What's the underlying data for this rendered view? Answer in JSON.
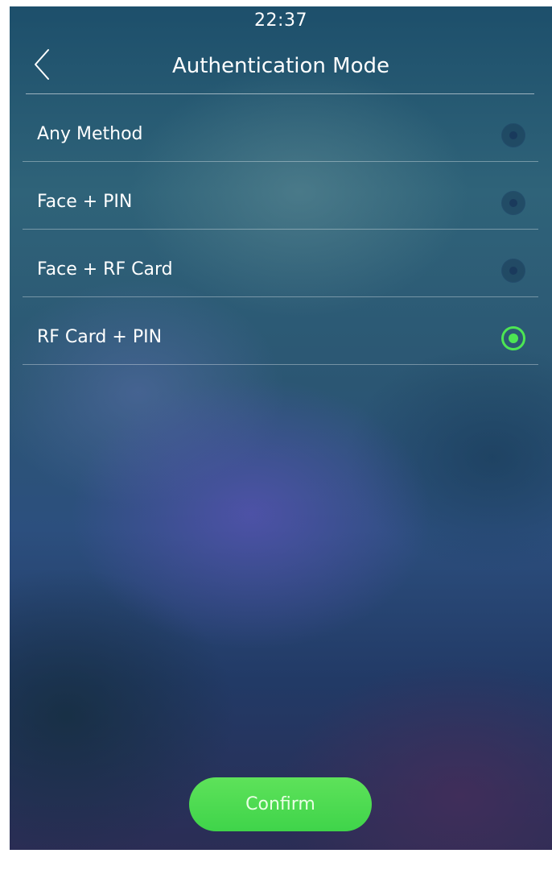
{
  "status_bar": {
    "time": "22:37"
  },
  "header": {
    "title": "Authentication Mode",
    "back_icon": "chevron-left-icon"
  },
  "options": [
    {
      "label": "Any Method",
      "selected": false
    },
    {
      "label": "Face + PIN",
      "selected": false
    },
    {
      "label": "Face + RF Card",
      "selected": false
    },
    {
      "label": "RF Card + PIN",
      "selected": true
    }
  ],
  "confirm_label": "Confirm",
  "colors": {
    "accent": "#4de653",
    "text": "#ffffff"
  }
}
